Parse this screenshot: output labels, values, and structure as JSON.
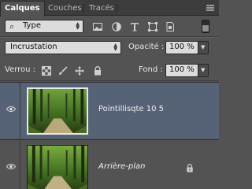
{
  "tabs": [
    {
      "label": "Calques",
      "active": true
    },
    {
      "label": "Couches",
      "active": false
    },
    {
      "label": "Tracés",
      "active": false
    }
  ],
  "filter": {
    "value": "Type",
    "icons": [
      "image-filter-icon",
      "adjustment-filter-icon",
      "text-filter-icon",
      "shape-filter-icon",
      "smart-object-filter-icon"
    ]
  },
  "blend": {
    "mode": "Incrustation",
    "opacity_label": "Opacité :",
    "opacity_value": "100 %",
    "fill_label": "Fond :",
    "fill_value": "100 %"
  },
  "lock": {
    "label": "Verrou :"
  },
  "layers": [
    {
      "name": "Pointillisqte 10 5",
      "visible": true,
      "selected": true,
      "locked": false
    },
    {
      "name": "Arrière-plan",
      "visible": true,
      "selected": false,
      "locked": true
    }
  ],
  "colors": {
    "panel": "#535353",
    "selected_layer": "#566275"
  }
}
